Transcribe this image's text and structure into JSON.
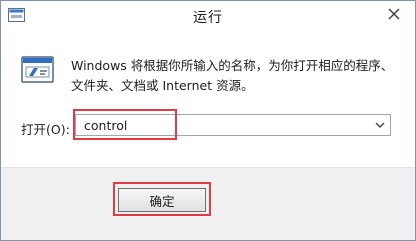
{
  "window": {
    "title": "运行"
  },
  "icons": {
    "app": "run-app-icon",
    "run": "run-dialog-icon",
    "close": "close-icon",
    "dropdown": "chevron-down-icon"
  },
  "dialog": {
    "description": "Windows 将根据你所输入的名称，为你打开相应的程序、文件夹、文档或 Internet 资源。",
    "open_label": "打开(O):",
    "open_value": "control",
    "ok_label": "确定"
  },
  "colors": {
    "highlight": "#e03c43",
    "footer_bg": "#f0f0f0",
    "border": "#7f93ad"
  }
}
